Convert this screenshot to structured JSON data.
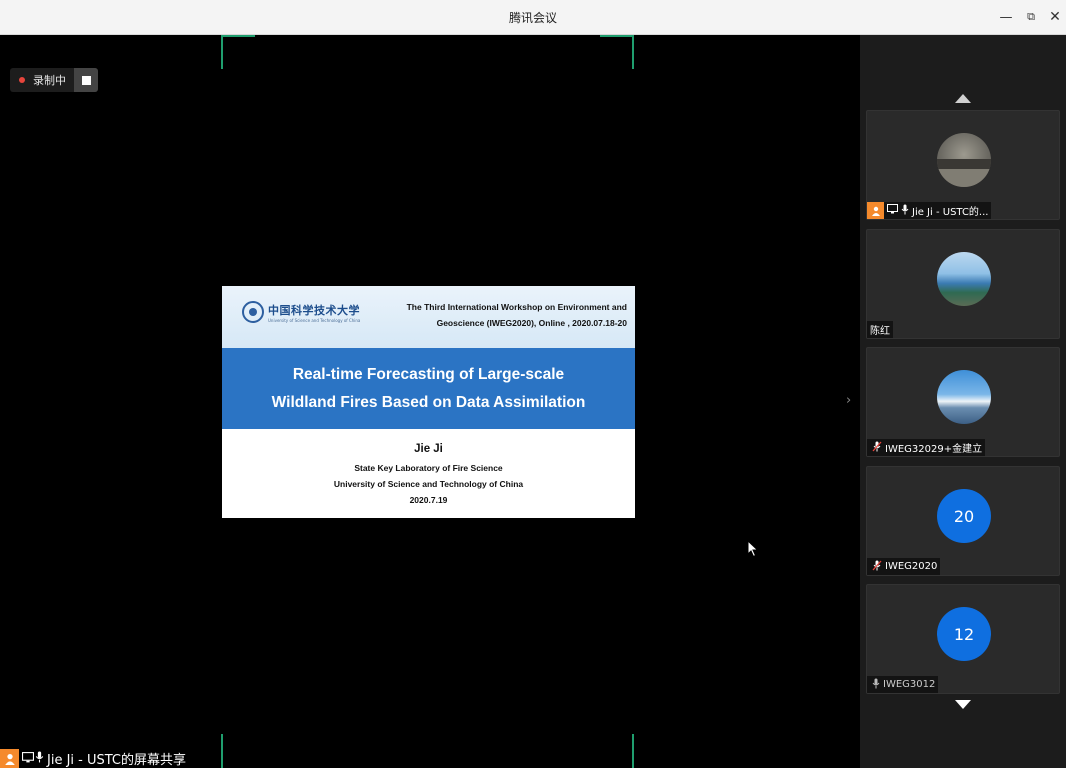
{
  "window": {
    "title": "腾讯会议",
    "minimize_glyph": "—",
    "restore_glyph": "⧉",
    "close_glyph": "✕"
  },
  "recording": {
    "label": "录制中"
  },
  "slide": {
    "university_name": "中国科学技术大学",
    "university_name_en": "University of Science and Technology of China",
    "workshop_line1": "The Third International Workshop on Environment and",
    "workshop_line2": "Geoscience (IWEG2020), Online , 2020.07.18-20",
    "title_line1": "Real-time Forecasting of Large-scale",
    "title_line2": "Wildland Fires Based on Data Assimilation",
    "author": "Jie Ji",
    "affiliation1": "State Key Laboratory of Fire Science",
    "affiliation2": "University of Science and Technology of China",
    "date": "2020.7.19"
  },
  "share_tag": {
    "name": "Jie Ji - USTC的屏幕共享"
  },
  "participants": [
    {
      "name": "Jie Ji - USTC的...",
      "avatar": "photo-lake",
      "host": true,
      "sharing": true,
      "mic": "on"
    },
    {
      "name": "陈红",
      "avatar": "photo-coast",
      "host": false,
      "sharing": false,
      "mic": "none"
    },
    {
      "name": "IWEG32029+金建立",
      "avatar": "photo-mountain",
      "host": false,
      "sharing": false,
      "mic": "muted"
    },
    {
      "name": "IWEG2020",
      "avatar": "number",
      "avatar_text": "20",
      "host": false,
      "sharing": false,
      "mic": "muted"
    },
    {
      "name": "IWEG3012",
      "avatar": "number",
      "avatar_text": "12",
      "host": false,
      "sharing": false,
      "mic": "on"
    }
  ],
  "colors": {
    "accent_green": "#1f9e6e",
    "host_orange": "#f58a2c",
    "avatar_blue": "#0f6fe0",
    "slide_band_blue": "#2b74c4",
    "recording_red": "#e8453c"
  }
}
